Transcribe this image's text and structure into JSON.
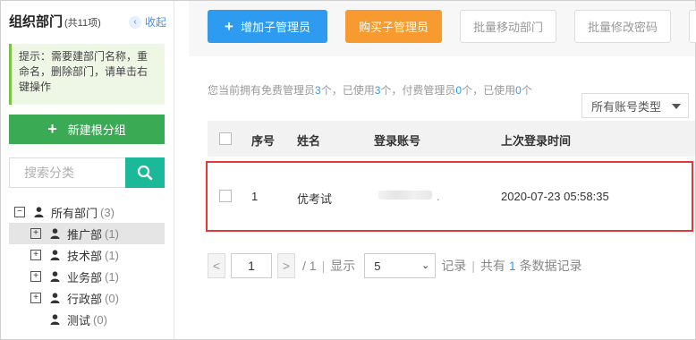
{
  "sidebar": {
    "title": "组织部门",
    "count": "(共11项)",
    "collapse_label": "收起",
    "tip": "提示：需要建部门名称，重命名，删除部门，请单击右键操作",
    "new_root_label": "新建根分组",
    "search_placeholder": "搜索分类",
    "tree": [
      {
        "label": "所有部门",
        "count": "(3)",
        "toggle": "−"
      },
      {
        "label": "推广部",
        "count": "(1)",
        "toggle": "+"
      },
      {
        "label": "技术部",
        "count": "(1)",
        "toggle": "+"
      },
      {
        "label": "业务部",
        "count": "(1)",
        "toggle": "+"
      },
      {
        "label": "行政部",
        "count": "(0)",
        "toggle": "+"
      },
      {
        "label": "测试",
        "count": "(0)",
        "toggle": ""
      }
    ]
  },
  "toolbar": {
    "add_label": "增加子管理员",
    "buy_label": "购买子管理员",
    "move_label": "批量移动部门",
    "pwd_label": "批量修改密码"
  },
  "info": {
    "p1": "您当前拥有免费管理员",
    "free_count": "3",
    "p2": "个，已使用",
    "used_count": "3",
    "p3": "个，付费管理员",
    "paid_count": "0",
    "p4": "个，已使用",
    "paid_used": "0",
    "p5": "个"
  },
  "account_type_select": "所有账号类型",
  "table": {
    "headers": {
      "index": "序号",
      "name": "姓名",
      "account": "登录账号",
      "last_login": "上次登录时间"
    },
    "rows": [
      {
        "index": "1",
        "name": "优考试",
        "account": ".",
        "last_login": "2020-07-23 05:58:35"
      }
    ]
  },
  "pager": {
    "prev": "<",
    "page": "1",
    "next": ">",
    "total_pages": "/ 1",
    "show_label": "显示",
    "page_size": "5",
    "records_label": "记录",
    "total_prefix": "共有",
    "total_count": "1",
    "total_suffix": "条数据记录"
  },
  "colors": {
    "primary_blue": "#2d9cf0",
    "orange": "#f79a2f",
    "green": "#3aab54",
    "teal": "#1bb89a",
    "highlight_red": "#e03a3a"
  }
}
